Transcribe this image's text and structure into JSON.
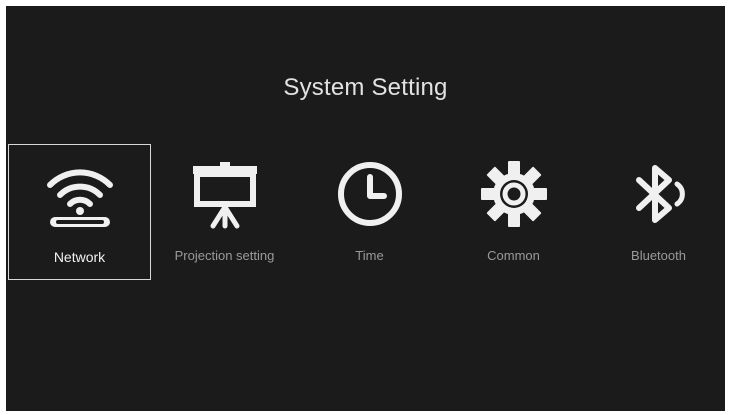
{
  "screen": {
    "title": "System Setting"
  },
  "menu": {
    "selected": "network",
    "items": [
      {
        "id": "network",
        "label": "Network",
        "icon": "wifi-router-icon"
      },
      {
        "id": "projection",
        "label": "Projection setting",
        "icon": "projector-screen-icon"
      },
      {
        "id": "time",
        "label": "Time",
        "icon": "clock-icon"
      },
      {
        "id": "common",
        "label": "Common",
        "icon": "gear-icon"
      },
      {
        "id": "bluetooth",
        "label": "Bluetooth",
        "icon": "bluetooth-icon"
      }
    ]
  },
  "colors": {
    "background": "#1b1b1b",
    "icon": "#f0f0f0",
    "selected_border": "#d8d8d8",
    "label": "#9a9a9a",
    "selected_label": "#f2f2f2"
  }
}
